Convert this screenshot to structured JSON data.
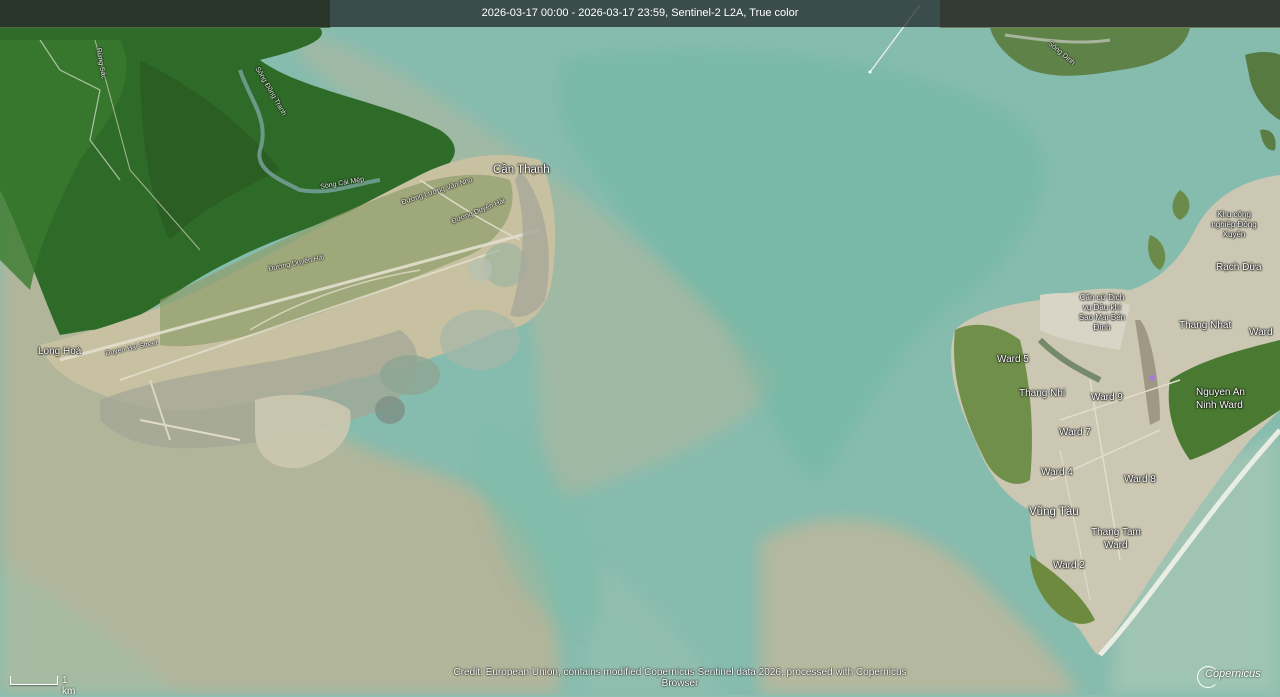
{
  "header": {
    "title": "2026-03-17 00:00 - 2026-03-17 23:59, Sentinel-2 L2A, True color"
  },
  "labels": {
    "can_thanh": "Cần Thạnh",
    "long_hoa": "Long Hoà",
    "rach_dua": "Rạch Dừa",
    "thang_nhat": "Thang Nhat",
    "ward": "Ward",
    "ward5": "Ward 5",
    "thang_nhi": "Thang Nhi",
    "ward9": "Ward 9",
    "ward7": "Ward 7",
    "ward4": "Ward 4",
    "ward8": "Ward 8",
    "vung_tau": "Vũng Tàu",
    "thang_tam": "Thang Tam",
    "thang_tam_ward": "Ward",
    "ward2": "Ward 2",
    "nguyen_an": "Nguyen An",
    "ninh_ward": "Ninh Ward",
    "khu_cong_nghiep": "Khu công nghiệp Đông Xuyên",
    "can_cu": "Căn cứ Dịch vụ Dầu khí Sao Mai-Bến Đình",
    "road_duyen_hai": "Duyen Hai Street",
    "road_duong_duyen_hai": "Đường Duyên Hải",
    "road_duong_luong_van_nho": "Đường Lương Văn Nho",
    "road_duong_duyen_hai2": "Đường Duyên Hải",
    "river1": "Sông Đồng Tranh",
    "river2": "Sông Cái Mép",
    "road_rung_sac": "Rừng Sác",
    "river3": "Sông Dinh"
  },
  "scale": {
    "label": "1 km"
  },
  "credit": {
    "line1": "Credit: European Union, contains modified Copernicus Sentinel data 2026, processed with Copernicus",
    "line2": "Browser"
  },
  "logo": {
    "text": "Copernicus"
  },
  "colors": {
    "water": "#8fbeb0",
    "sediment": "#b9b59a",
    "mangrove": "#2f6a2a",
    "urban": "#cfcbb8"
  }
}
